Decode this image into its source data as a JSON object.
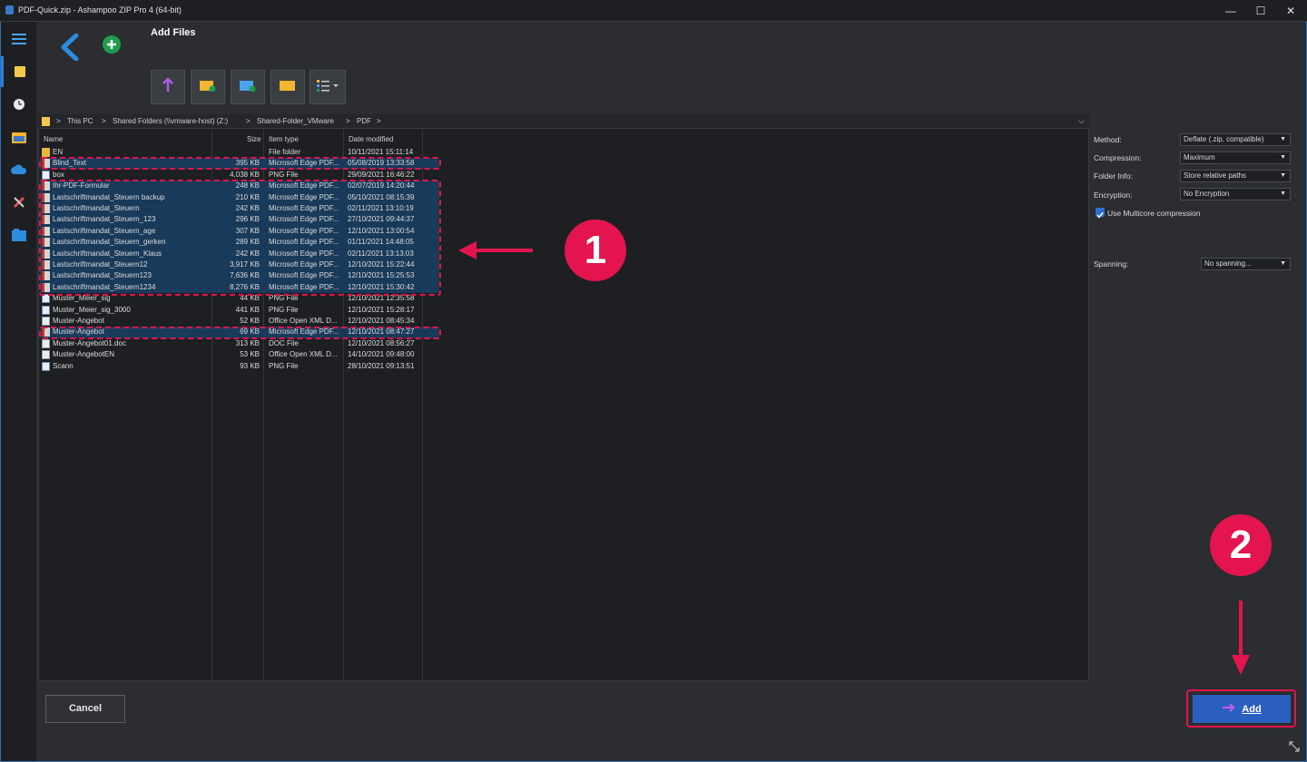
{
  "window": {
    "title": "PDF-Quick.zip - Ashampoo ZIP Pro 4 (64-bit)",
    "minimize": "—",
    "maximize": "☐",
    "close": "✕"
  },
  "header": {
    "title": "Add Files"
  },
  "breadcrumb": [
    "This PC",
    "Shared Folders (\\\\vmware-host) (Z:)",
    "Shared-Folder_VMware",
    "PDF"
  ],
  "columns": {
    "name": "Name",
    "size": "Size",
    "type": "Item type",
    "date": "Date modified"
  },
  "files": [
    {
      "name": "EN",
      "size": "",
      "type": "File folder",
      "date": "10/11/2021 15:11:14",
      "icon": "folder"
    },
    {
      "name": "Blind_Text",
      "size": "395 KB",
      "type": "Microsoft Edge PDF...",
      "date": "05/08/2019 13:33:58",
      "icon": "pdf"
    },
    {
      "name": "box",
      "size": "4,038 KB",
      "type": "PNG File",
      "date": "29/09/2021 16:46:22",
      "icon": "png"
    },
    {
      "name": "Ihr-PDF-Formular",
      "size": "248 KB",
      "type": "Microsoft Edge PDF...",
      "date": "02/07/2019 14:20:44",
      "icon": "pdf"
    },
    {
      "name": "Lastschriftmandat_Steuern backup",
      "size": "210 KB",
      "type": "Microsoft Edge PDF...",
      "date": "05/10/2021 08:15:39",
      "icon": "pdf"
    },
    {
      "name": "Lastschriftmandat_Steuern",
      "size": "242 KB",
      "type": "Microsoft Edge PDF...",
      "date": "02/11/2021 13:10:19",
      "icon": "pdf"
    },
    {
      "name": "Lastschriftmandat_Steuern_123",
      "size": "296 KB",
      "type": "Microsoft Edge PDF...",
      "date": "27/10/2021 09:44:37",
      "icon": "pdf"
    },
    {
      "name": "Lastschriftmandat_Steuern_age",
      "size": "307 KB",
      "type": "Microsoft Edge PDF...",
      "date": "12/10/2021 13:00:54",
      "icon": "pdf"
    },
    {
      "name": "Lastschriftmandat_Steuern_gerken",
      "size": "289 KB",
      "type": "Microsoft Edge PDF...",
      "date": "01/11/2021 14:48:05",
      "icon": "pdf"
    },
    {
      "name": "Lastschriftmandat_Steuern_Klaus",
      "size": "242 KB",
      "type": "Microsoft Edge PDF...",
      "date": "02/11/2021 13:13:03",
      "icon": "pdf"
    },
    {
      "name": "Lastschriftmandat_Steuern12",
      "size": "3,917 KB",
      "type": "Microsoft Edge PDF...",
      "date": "12/10/2021 15:22:44",
      "icon": "pdf"
    },
    {
      "name": "Lastschriftmandat_Steuern123",
      "size": "7,636 KB",
      "type": "Microsoft Edge PDF...",
      "date": "12/10/2021 15:25:53",
      "icon": "pdf"
    },
    {
      "name": "Lastschriftmandat_Steuern1234",
      "size": "8,276 KB",
      "type": "Microsoft Edge PDF...",
      "date": "12/10/2021 15:30:42",
      "icon": "pdf"
    },
    {
      "name": "Muster_Meier_sig",
      "size": "44 KB",
      "type": "PNG File",
      "date": "12/10/2021 12:35:58",
      "icon": "png"
    },
    {
      "name": "Muster_Meier_sig_3000",
      "size": "441 KB",
      "type": "PNG File",
      "date": "12/10/2021 15:28:17",
      "icon": "png"
    },
    {
      "name": "Muster-Angebot",
      "size": "52 KB",
      "type": "Office Open XML D...",
      "date": "12/10/2021 08:45:34",
      "icon": "doc"
    },
    {
      "name": "Muster-Angebot",
      "size": "69 KB",
      "type": "Microsoft Edge PDF...",
      "date": "12/10/2021 08:47:27",
      "icon": "pdf"
    },
    {
      "name": "Muster-Angebot01.doc",
      "size": "313 KB",
      "type": "DOC File",
      "date": "12/10/2021 08:56:27",
      "icon": "doc"
    },
    {
      "name": "Muster-AngebotEN",
      "size": "53 KB",
      "type": "Office Open XML D...",
      "date": "14/10/2021 09:48:00",
      "icon": "doc"
    },
    {
      "name": "Scann",
      "size": "93 KB",
      "type": "PNG File",
      "date": "28/10/2021 09:13:51",
      "icon": "png"
    }
  ],
  "options": {
    "method_label": "Method:",
    "method_value": "Deflate (.zip, compatible)",
    "compression_label": "Compression:",
    "compression_value": "Maximum",
    "folder_info_label": "Folder Info:",
    "folder_info_value": "Store relative paths",
    "encryption_label": "Encryption:",
    "encryption_value": "No Encryption",
    "multicore_label": "Use Multicore compression",
    "spanning_label": "Spanning:",
    "spanning_value": "No spanning..."
  },
  "buttons": {
    "cancel": "Cancel",
    "add": "Add"
  },
  "annotations": {
    "step1": "1",
    "step2": "2"
  },
  "colors": {
    "accent": "#2a5fc0",
    "annotation": "#e3144f",
    "selection": "#193a5a"
  }
}
